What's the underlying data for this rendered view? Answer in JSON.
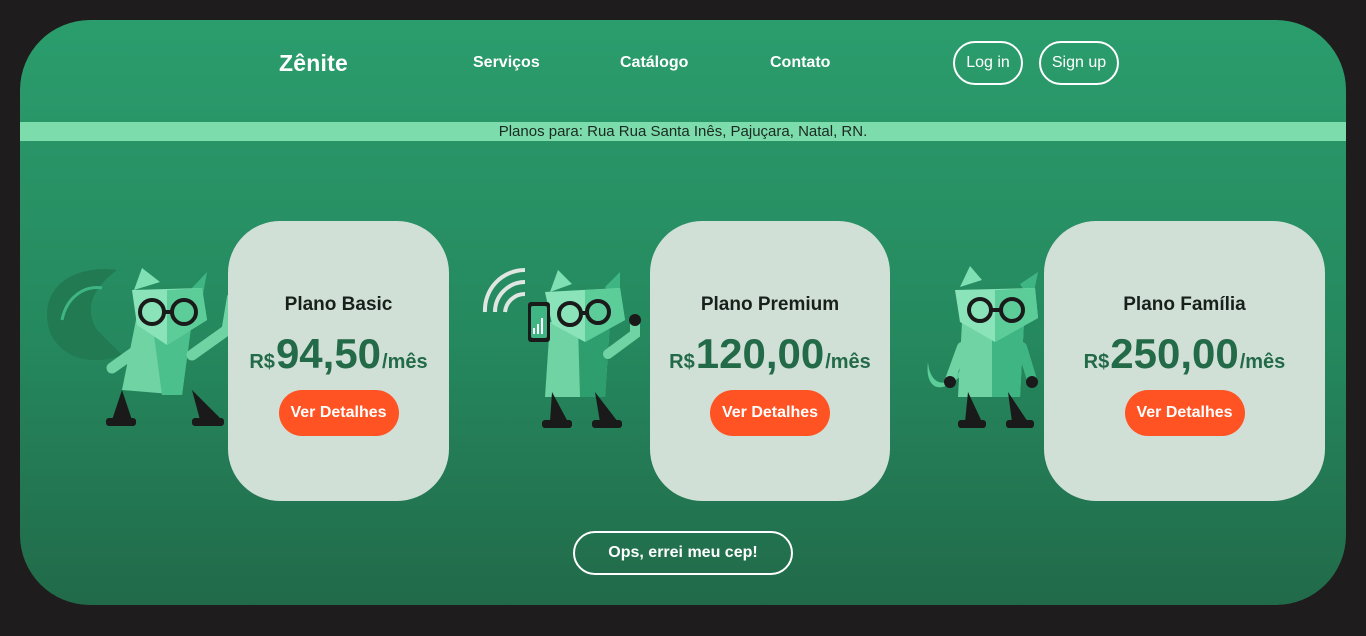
{
  "header": {
    "brand": "Zênite",
    "nav": [
      "Serviços",
      "Catálogo",
      "Contato"
    ],
    "login_label": "Log in",
    "signup_label": "Sign up"
  },
  "address_banner": "Planos para: Rua Rua Santa Inês, Pajuçara, Natal, RN.",
  "plans": [
    {
      "name": "Plano Basic",
      "currency": "R$",
      "amount": "94,50",
      "period": "/mês",
      "button": "Ver Detalhes"
    },
    {
      "name": "Plano Premium",
      "currency": "R$",
      "amount": "120,00",
      "period": "/mês",
      "button": "Ver Detalhes"
    },
    {
      "name": "Plano Família",
      "currency": "R$",
      "amount": "250,00",
      "period": "/mês",
      "button": "Ver Detalhes"
    }
  ],
  "cep_button": "Ops, errei meu cep!",
  "colors": {
    "background": "#1e1c1c",
    "frame_green": "#2b9d6d",
    "banner_green": "#7cdcac",
    "card_bg": "#d1e0d7",
    "price_green": "#236a48",
    "accent_orange": "#ff5323"
  },
  "icons": [
    "fox-mascot-dancing-icon",
    "fox-mascot-phone-wifi-icon",
    "fox-mascot-standing-icon"
  ]
}
